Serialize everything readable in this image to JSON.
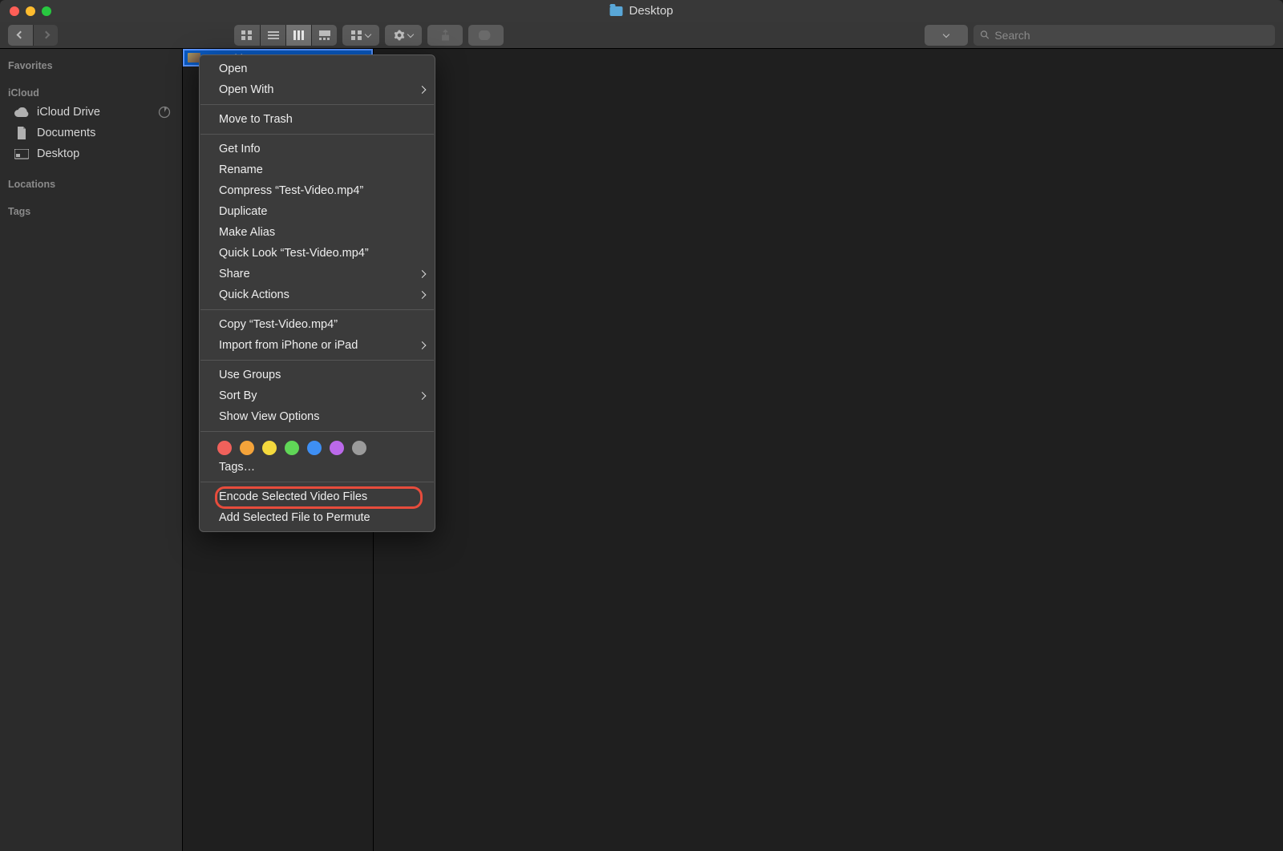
{
  "window": {
    "title": "Desktop"
  },
  "search": {
    "placeholder": "Search"
  },
  "sidebar": {
    "sections": [
      {
        "header": "Favorites",
        "items": []
      },
      {
        "header": "iCloud",
        "items": [
          {
            "label": "iCloud Drive",
            "icon": "cloud",
            "aux": "pie"
          },
          {
            "label": "Documents",
            "icon": "doc"
          },
          {
            "label": "Desktop",
            "icon": "desktop"
          }
        ]
      },
      {
        "header": "Locations",
        "items": []
      },
      {
        "header": "Tags",
        "items": []
      }
    ]
  },
  "file": {
    "name": "Test-Vid…"
  },
  "context_menu": {
    "groups": [
      [
        {
          "label": "Open"
        },
        {
          "label": "Open With",
          "submenu": true
        }
      ],
      [
        {
          "label": "Move to Trash"
        }
      ],
      [
        {
          "label": "Get Info"
        },
        {
          "label": "Rename"
        },
        {
          "label": "Compress “Test-Video.mp4”"
        },
        {
          "label": "Duplicate"
        },
        {
          "label": "Make Alias"
        },
        {
          "label": "Quick Look “Test-Video.mp4”"
        },
        {
          "label": "Share",
          "submenu": true
        },
        {
          "label": "Quick Actions",
          "submenu": true
        }
      ],
      [
        {
          "label": "Copy “Test-Video.mp4”"
        },
        {
          "label": "Import from iPhone or iPad",
          "submenu": true
        }
      ],
      [
        {
          "label": "Use Groups"
        },
        {
          "label": "Sort By",
          "submenu": true
        },
        {
          "label": "Show View Options"
        }
      ]
    ],
    "tags_colors": [
      "#f0615b",
      "#f4a33a",
      "#f4d93d",
      "#60d657",
      "#3e8ff4",
      "#bb69ea",
      "#9b9b9b"
    ],
    "tags_label": "Tags…",
    "final": [
      {
        "label": "Encode Selected Video Files",
        "highlight": true
      },
      {
        "label": "Add Selected File to Permute"
      }
    ]
  }
}
